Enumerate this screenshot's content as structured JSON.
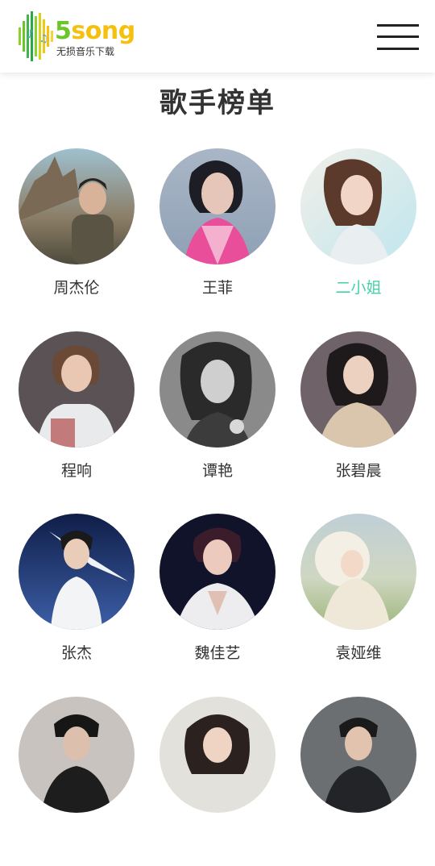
{
  "header": {
    "logo": {
      "brand_five": "5",
      "brand_song": "song",
      "tagline": "无损音乐下载"
    },
    "menu_icon": "hamburger-menu-icon"
  },
  "page": {
    "title": "歌手榜单"
  },
  "colors": {
    "accent": "#45d1a8",
    "logo_green": "#6cc62a",
    "logo_yellow": "#f5c10e",
    "text": "#333333"
  },
  "artists": [
    {
      "name": "周杰伦",
      "active": false
    },
    {
      "name": "王菲",
      "active": false
    },
    {
      "name": "二小姐",
      "active": true
    },
    {
      "name": "程响",
      "active": false
    },
    {
      "name": "谭艳",
      "active": false
    },
    {
      "name": "张碧晨",
      "active": false
    },
    {
      "name": "张杰",
      "active": false
    },
    {
      "name": "魏佳艺",
      "active": false
    },
    {
      "name": "袁娅维",
      "active": false
    },
    {
      "name": "",
      "active": false
    },
    {
      "name": "",
      "active": false
    },
    {
      "name": "",
      "active": false
    }
  ]
}
